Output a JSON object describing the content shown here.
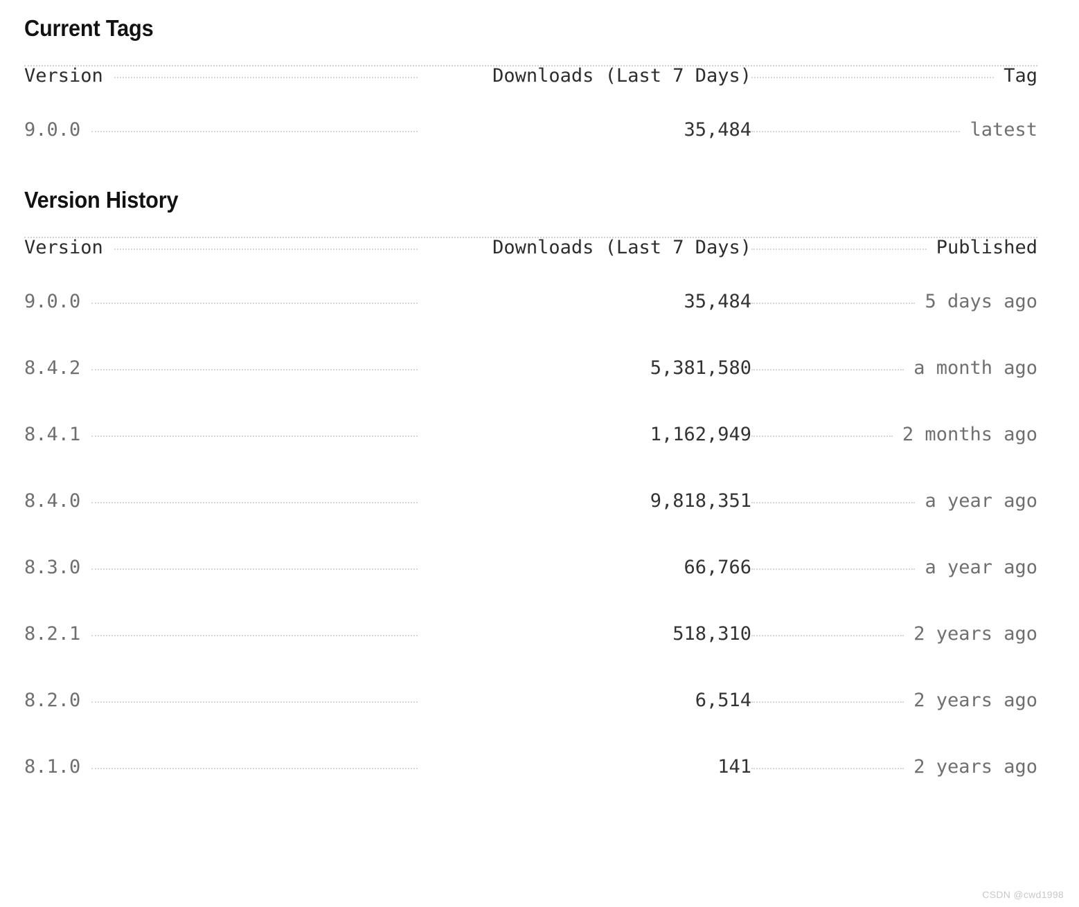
{
  "sections": [
    {
      "id": "current-tags",
      "heading": "Current Tags",
      "columns": [
        "Version",
        "Downloads (Last 7 Days)",
        "Tag"
      ],
      "rows": [
        {
          "version": "9.0.0",
          "downloads": "35,484",
          "end": "latest"
        }
      ]
    },
    {
      "id": "version-history",
      "heading": "Version History",
      "columns": [
        "Version",
        "Downloads (Last 7 Days)",
        "Published"
      ],
      "rows": [
        {
          "version": "9.0.0",
          "downloads": "35,484",
          "end": "5 days ago"
        },
        {
          "version": "8.4.2",
          "downloads": "5,381,580",
          "end": "a month ago"
        },
        {
          "version": "8.4.1",
          "downloads": "1,162,949",
          "end": "2 months ago"
        },
        {
          "version": "8.4.0",
          "downloads": "9,818,351",
          "end": "a year ago"
        },
        {
          "version": "8.3.0",
          "downloads": "66,766",
          "end": "a year ago"
        },
        {
          "version": "8.2.1",
          "downloads": "518,310",
          "end": "2 years ago"
        },
        {
          "version": "8.2.0",
          "downloads": "6,514",
          "end": "2 years ago"
        },
        {
          "version": "8.1.0",
          "downloads": "141",
          "end": "2 years ago"
        }
      ]
    }
  ],
  "watermark": "CSDN @cwd1998",
  "colors": {
    "heading": "#121212",
    "column_header": "#2d2d2d",
    "version_text": "#6f6f6f",
    "downloads_text": "#333333",
    "meta_text": "#6f6f6f",
    "leader_dots": "#d6d6d6",
    "section_rule": "#cfcfcf",
    "background": "#ffffff",
    "watermark": "#c8c8c8"
  }
}
